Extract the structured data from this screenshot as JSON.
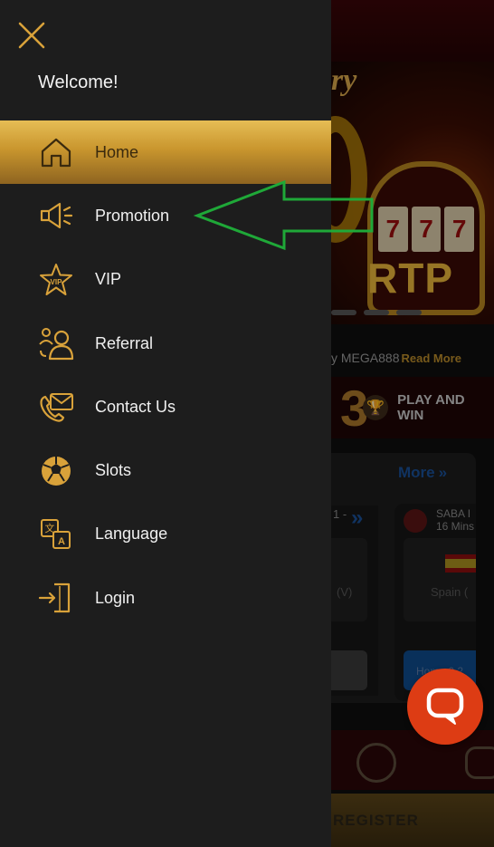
{
  "drawer": {
    "welcome": "Welcome!",
    "items": [
      {
        "label": "Home",
        "icon": "home-icon",
        "active": true
      },
      {
        "label": "Promotion",
        "icon": "megaphone-icon",
        "active": false
      },
      {
        "label": "VIP",
        "icon": "vip-star-icon",
        "active": false
      },
      {
        "label": "Referral",
        "icon": "referral-users-icon",
        "active": false
      },
      {
        "label": "Contact Us",
        "icon": "contact-envelope-icon",
        "active": false
      },
      {
        "label": "Slots",
        "icon": "soccer-ball-icon",
        "active": false
      },
      {
        "label": "Language",
        "icon": "language-icon",
        "active": false
      },
      {
        "label": "Login",
        "icon": "login-icon",
        "active": false
      }
    ]
  },
  "background": {
    "banner": {
      "top_text": "ry",
      "reels": [
        "7",
        "7",
        "7"
      ],
      "tag": "RTP"
    },
    "marquee": {
      "text": "y MEGA888",
      "read_more": "Read More"
    },
    "play": {
      "number": "3",
      "text_line1": "PLAY AND",
      "text_line2": "WIN"
    },
    "more_link": "More",
    "match_card_1": {
      "title": "1 -",
      "team": "(V)"
    },
    "match_card_2": {
      "league_line1": "SABA I",
      "league_line2": "16 Mins",
      "team": "Spain (",
      "button": "Home 0.2"
    },
    "register": "REGISTER"
  },
  "colors": {
    "accent_gold": "#c9962e",
    "drawer_bg": "#1d1d1d",
    "chat_red": "#dd3c14",
    "annotation_green": "#1fa838"
  }
}
